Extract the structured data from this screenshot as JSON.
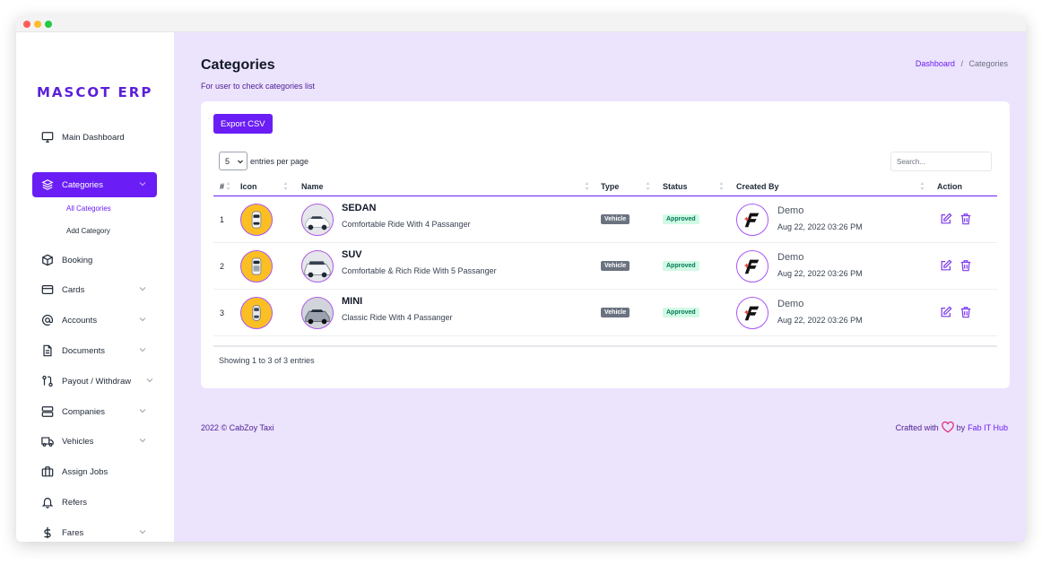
{
  "app": {
    "logo": "MASCOT ERP"
  },
  "sidebar": {
    "items": [
      {
        "label": "Main Dashboard",
        "icon": "monitor-icon",
        "has_children": false,
        "active": false
      },
      {
        "label": "Categories",
        "icon": "layers-icon",
        "has_children": true,
        "active": true
      },
      {
        "label": "Booking",
        "icon": "cube-icon",
        "has_children": false,
        "active": false
      },
      {
        "label": "Cards",
        "icon": "card-icon",
        "has_children": true,
        "active": false
      },
      {
        "label": "Accounts",
        "icon": "at-icon",
        "has_children": true,
        "active": false
      },
      {
        "label": "Documents",
        "icon": "document-icon",
        "has_children": true,
        "active": false
      },
      {
        "label": "Payout / Withdraw",
        "icon": "transfer-icon",
        "has_children": true,
        "active": false
      },
      {
        "label": "Companies",
        "icon": "server-icon",
        "has_children": true,
        "active": false
      },
      {
        "label": "Vehicles",
        "icon": "truck-icon",
        "has_children": true,
        "active": false
      },
      {
        "label": "Assign Jobs",
        "icon": "briefcase-icon",
        "has_children": false,
        "active": false
      },
      {
        "label": "Refers",
        "icon": "bell-icon",
        "has_children": false,
        "active": false
      },
      {
        "label": "Fares",
        "icon": "dollar-icon",
        "has_children": true,
        "active": false
      }
    ],
    "subitems": [
      {
        "label": "All Categories",
        "active": true
      },
      {
        "label": "Add Category",
        "active": false
      }
    ]
  },
  "header": {
    "title": "Categories",
    "subtitle": "For user to check categories list",
    "breadcrumb": {
      "home": "Dashboard",
      "separator": "/",
      "current": "Categories"
    }
  },
  "toolbar": {
    "export_label": "Export CSV",
    "entries_value": "5",
    "entries_label": "entries per page",
    "search_placeholder": "Search..."
  },
  "table": {
    "columns": [
      "#",
      "Icon",
      "Name",
      "Type",
      "Status",
      "Created By",
      "Action"
    ],
    "rows": [
      {
        "num": "1",
        "name": "SEDAN",
        "description": "Comfortable Ride With 4 Passanger",
        "type": "Vehicle",
        "status": "Approved",
        "creator": "Demo",
        "date": "Aug 22, 2022 03:26 PM"
      },
      {
        "num": "2",
        "name": "SUV",
        "description": "Comfortable & Rich Ride With 5 Passanger",
        "type": "Vehicle",
        "status": "Approved",
        "creator": "Demo",
        "date": "Aug 22, 2022 03:26 PM"
      },
      {
        "num": "3",
        "name": "MINI",
        "description": "Classic Ride With 4 Passanger",
        "type": "Vehicle",
        "status": "Approved",
        "creator": "Demo",
        "date": "Aug 22, 2022 03:26 PM"
      }
    ],
    "showing": "Showing 1 to 3 of 3 entries"
  },
  "footer": {
    "copyright": "2022 © CabZoy Taxi",
    "crafted_prefix": "Crafted with",
    "crafted_by": "by",
    "brand": "Fab IT Hub"
  },
  "colors": {
    "accent": "#6a1ef5",
    "background": "#ece3fc",
    "approved_bg": "#d1fae5",
    "approved_text": "#047857"
  }
}
